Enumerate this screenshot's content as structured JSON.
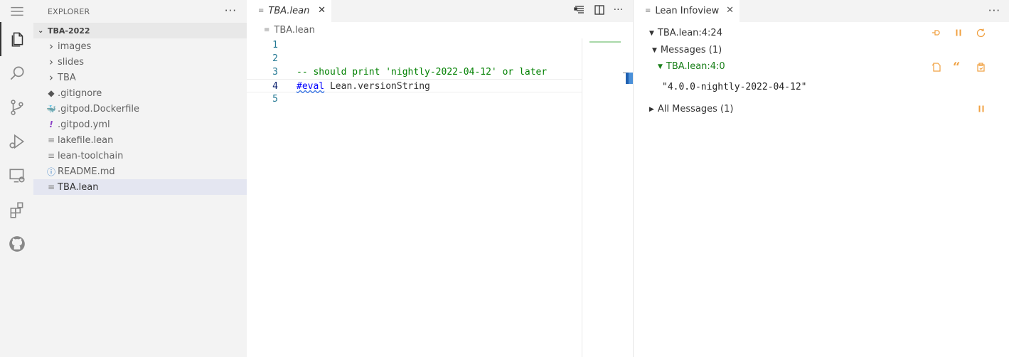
{
  "activity_bar": {
    "icons": [
      "explorer-icon",
      "search-icon",
      "source-control-icon",
      "run-debug-icon",
      "remote-explorer-icon",
      "extensions-icon",
      "github-icon"
    ]
  },
  "sidebar": {
    "title": "EXPLORER",
    "more": "···",
    "folder": "TBA-2022",
    "items": [
      {
        "label": "images",
        "icon": "›"
      },
      {
        "label": "slides",
        "icon": "›"
      },
      {
        "label": "TBA",
        "icon": "›"
      },
      {
        "label": ".gitignore",
        "icon": "◆"
      },
      {
        "label": ".gitpod.Dockerfile",
        "icon": "🐳"
      },
      {
        "label": ".gitpod.yml",
        "icon": "!"
      },
      {
        "label": "lakefile.lean",
        "icon": "≡"
      },
      {
        "label": "lean-toolchain",
        "icon": "≡"
      },
      {
        "label": "README.md",
        "icon": "ⓘ"
      },
      {
        "label": "TBA.lean",
        "icon": "≡"
      }
    ]
  },
  "editor": {
    "tab_label": "TBA.lean",
    "breadcrumb": "TBA.lean",
    "lines": [
      {
        "num": "1",
        "text": ""
      },
      {
        "num": "2",
        "text": ""
      },
      {
        "num": "3",
        "text": "-- should print 'nightly-2022-04-12' or later"
      },
      {
        "num": "4",
        "kw": "#eval",
        "rest": " Lean.versionString"
      },
      {
        "num": "5",
        "text": ""
      }
    ]
  },
  "infoview": {
    "tab_label": "Lean Infoview",
    "more": "···",
    "position": "TBA.lean:4:24",
    "messages": "Messages (1)",
    "message_loc": "TBA.lean:4:0",
    "result": "\"4.0.0-nightly-2022-04-12\"",
    "all_messages": "All Messages (1)"
  },
  "colors": {
    "accent_orange": "#f0a040",
    "comment_green": "#008000",
    "keyword_blue": "#0000ff"
  }
}
